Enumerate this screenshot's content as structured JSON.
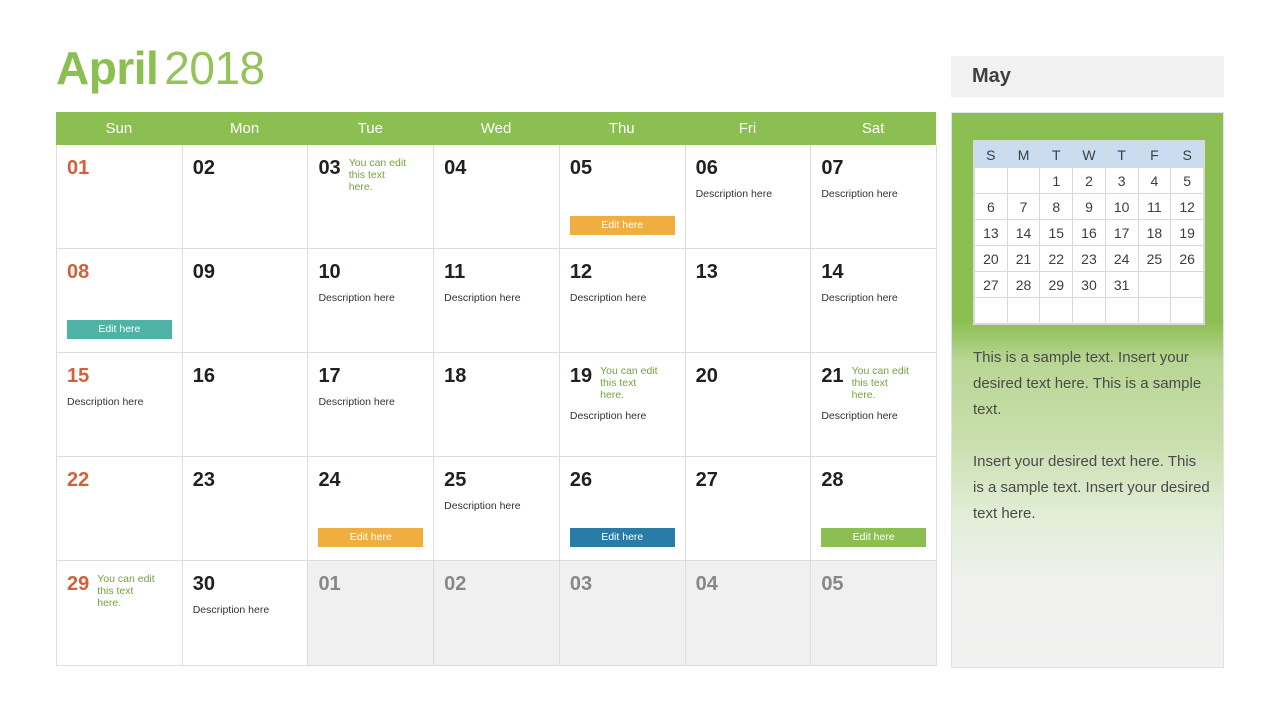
{
  "title": {
    "month": "April",
    "year": "2018"
  },
  "calendar": {
    "day_headers": [
      "Sun",
      "Mon",
      "Tue",
      "Wed",
      "Thu",
      "Fri",
      "Sat"
    ],
    "weeks": [
      [
        {
          "num": "01",
          "style": "weekend"
        },
        {
          "num": "02",
          "style": "normal"
        },
        {
          "num": "03",
          "style": "normal",
          "note": "You can edit this text here."
        },
        {
          "num": "04",
          "style": "normal"
        },
        {
          "num": "05",
          "style": "normal",
          "tag": "Edit here",
          "tag_color": "#EFAE3F"
        },
        {
          "num": "06",
          "style": "normal",
          "desc": "Description here"
        },
        {
          "num": "07",
          "style": "normal",
          "desc": "Description here"
        }
      ],
      [
        {
          "num": "08",
          "style": "weekend",
          "tag": "Edit here",
          "tag_color": "#4EB3A4"
        },
        {
          "num": "09",
          "style": "normal"
        },
        {
          "num": "10",
          "style": "normal",
          "desc": "Description here"
        },
        {
          "num": "11",
          "style": "normal",
          "desc": "Description here"
        },
        {
          "num": "12",
          "style": "normal",
          "desc": "Description here"
        },
        {
          "num": "13",
          "style": "normal"
        },
        {
          "num": "14",
          "style": "normal",
          "desc": "Description here"
        }
      ],
      [
        {
          "num": "15",
          "style": "weekend",
          "desc": "Description here"
        },
        {
          "num": "16",
          "style": "normal"
        },
        {
          "num": "17",
          "style": "normal",
          "desc": "Description here"
        },
        {
          "num": "18",
          "style": "normal"
        },
        {
          "num": "19",
          "style": "normal",
          "note": "You can edit this text here.",
          "desc": "Description here"
        },
        {
          "num": "20",
          "style": "normal"
        },
        {
          "num": "21",
          "style": "normal",
          "note": "You can edit this text here.",
          "desc": "Description here"
        }
      ],
      [
        {
          "num": "22",
          "style": "weekend"
        },
        {
          "num": "23",
          "style": "normal"
        },
        {
          "num": "24",
          "style": "normal",
          "tag": "Edit here",
          "tag_color": "#EFAE3F"
        },
        {
          "num": "25",
          "style": "normal",
          "desc": "Description here"
        },
        {
          "num": "26",
          "style": "normal",
          "tag": "Edit here",
          "tag_color": "#2A7CA8"
        },
        {
          "num": "27",
          "style": "normal"
        },
        {
          "num": "28",
          "style": "normal",
          "tag": "Edit here",
          "tag_color": "#8CBF52"
        }
      ],
      [
        {
          "num": "29",
          "style": "weekend",
          "note": "You can edit this text here."
        },
        {
          "num": "30",
          "style": "normal",
          "desc": "Description here"
        },
        {
          "num": "01",
          "style": "outside"
        },
        {
          "num": "02",
          "style": "outside"
        },
        {
          "num": "03",
          "style": "outside"
        },
        {
          "num": "04",
          "style": "outside"
        },
        {
          "num": "05",
          "style": "outside"
        }
      ]
    ]
  },
  "sidebar": {
    "header_label": "May",
    "mini_calendar": {
      "day_headers": [
        "S",
        "M",
        "T",
        "W",
        "T",
        "F",
        "S"
      ],
      "weeks": [
        [
          "",
          "",
          "1",
          "2",
          "3",
          "4",
          "5"
        ],
        [
          "6",
          "7",
          "8",
          "9",
          "10",
          "11",
          "12"
        ],
        [
          "13",
          "14",
          "15",
          "16",
          "17",
          "18",
          "19"
        ],
        [
          "20",
          "21",
          "22",
          "23",
          "24",
          "25",
          "26"
        ],
        [
          "27",
          "28",
          "29",
          "30",
          "31",
          "",
          ""
        ],
        [
          "",
          "",
          "",
          "",
          "",
          "",
          ""
        ]
      ]
    },
    "paragraphs": [
      "This is a sample text. Insert your desired text here. This is a sample text.",
      "Insert your desired text here. This is a sample text. Insert your desired text here."
    ]
  },
  "colors": {
    "brand_green": "#8CBF52",
    "weekend_red": "#D2603A",
    "tag_orange": "#EFAE3F",
    "tag_teal": "#4EB3A4",
    "tag_blue": "#2A7CA8",
    "tag_green": "#8CBF52",
    "mini_header_blue": "#C9DCF0"
  }
}
